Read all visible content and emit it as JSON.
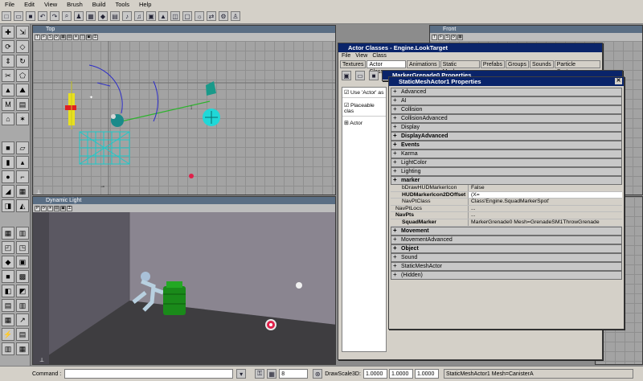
{
  "menu": [
    "File",
    "Edit",
    "View",
    "Brush",
    "Build",
    "Tools",
    "Help"
  ],
  "viewports": {
    "top": "Top",
    "front": "Front",
    "dynamic": "Dynamic Light"
  },
  "actor_classes": {
    "title": "Actor Classes - Engine.LookTarget",
    "menu": [
      "File",
      "View",
      "Class"
    ],
    "tabs": [
      "Textures",
      "Actor Classes",
      "Animations",
      "Static Meshes",
      "Prefabs",
      "Groups",
      "Sounds",
      "Particle Systems"
    ],
    "checks": [
      "Use 'Actor' as",
      "Placeable clas"
    ],
    "tree_root": "Actor"
  },
  "marker_props_title": "MarkerGrenade0 Properties",
  "props": {
    "title": "StaticMeshActor1 Properties",
    "groups_top": [
      "Advanced",
      "AI",
      "Collision",
      "CollisionAdvanced",
      "Display",
      "DisplayAdvanced",
      "Events",
      "Karma",
      "LightColor",
      "Lighting"
    ],
    "bold_top": [
      "DisplayAdvanced",
      "Events"
    ],
    "expanded_group": "marker",
    "rows": [
      {
        "k": "bDrawHUDMarkerIcon",
        "v": "False"
      },
      {
        "k": "HUDMarkerIcon2DOffset",
        "v": "(X="
      },
      {
        "k": "NavPtClass",
        "v": "Class'Engine.SquadMarkerSpot'"
      },
      {
        "k": "NavPtLocs",
        "v": "..."
      },
      {
        "k": "NavPts",
        "v": "..."
      },
      {
        "k": "SquadMarker",
        "v": "MarkerGrenade0 Mesh=GrenadeSM1ThrowGrenade"
      }
    ],
    "groups_bottom": [
      "Movement",
      "MovementAdvanced",
      "Object",
      "Sound",
      "StaticMeshActor",
      "(Hidden)"
    ],
    "bold_bottom": [
      "Movement",
      "Object"
    ]
  },
  "status": {
    "command_label": "Command :",
    "grid_value": "8",
    "drawscale_label": "DrawScale3D:",
    "scale_x": "1.0000",
    "scale_y": "1.0000",
    "scale_z": "1.0000",
    "selected": "StaticMeshActor1 Mesh=CanisterA"
  },
  "colors": {
    "titlebar": "#0a246a",
    "accent_cyan": "#1ec8c8",
    "accent_green": "#2db32d",
    "target_red": "#e0204a"
  }
}
